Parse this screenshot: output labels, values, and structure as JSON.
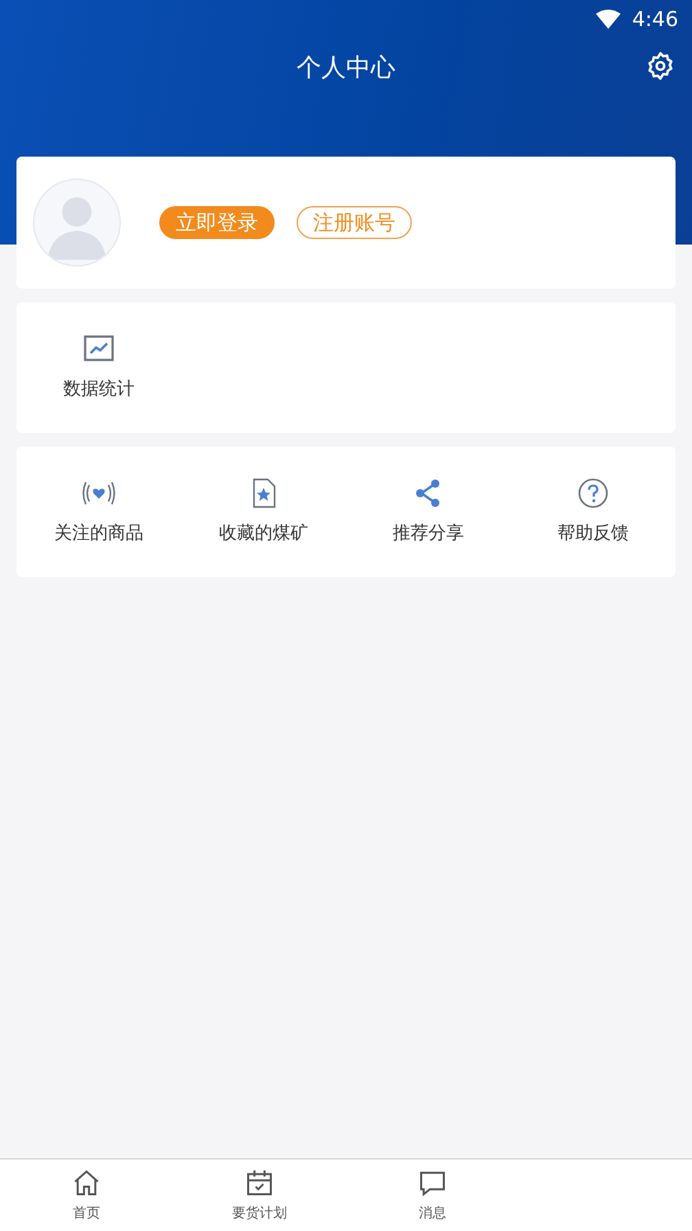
{
  "status_bar": {
    "time": "4:46"
  },
  "header": {
    "title": "个人中心"
  },
  "profile": {
    "login_button": "立即登录",
    "register_button": "注册账号"
  },
  "stats_card": {
    "items": [
      {
        "label": "数据统计"
      }
    ]
  },
  "tools_card": {
    "items": [
      {
        "label": "关注的商品"
      },
      {
        "label": "收藏的煤矿"
      },
      {
        "label": "推荐分享"
      },
      {
        "label": "帮助反馈"
      }
    ]
  },
  "bottom_nav": [
    {
      "label": "首页",
      "selected": false
    },
    {
      "label": "要货计划",
      "selected": false
    },
    {
      "label": "消息",
      "selected": false
    }
  ]
}
